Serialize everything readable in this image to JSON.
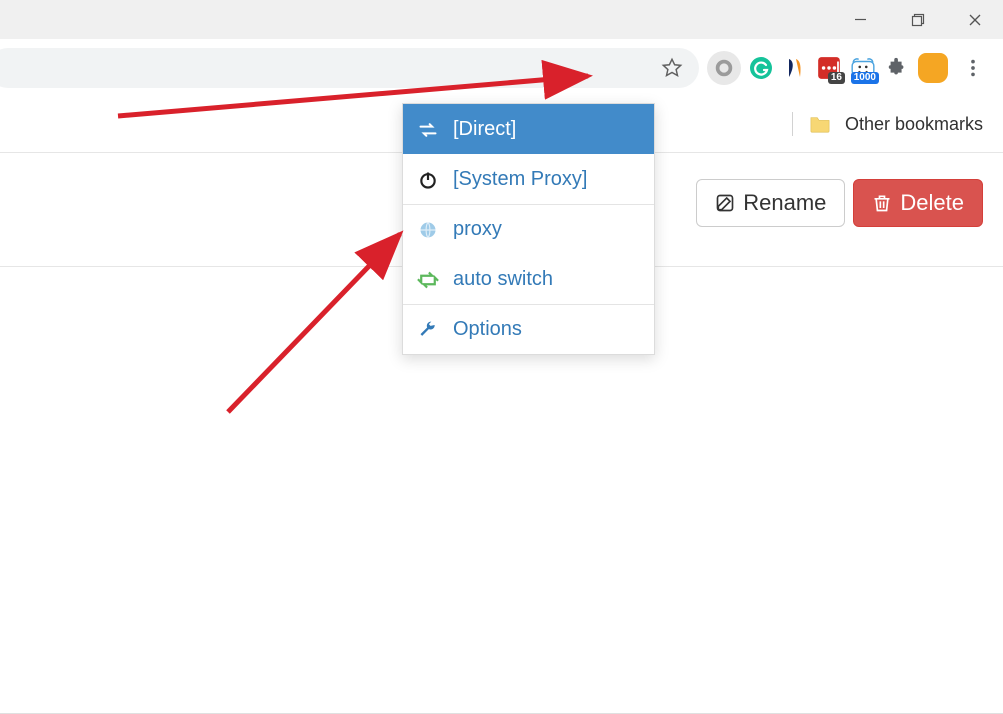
{
  "window_controls": {
    "min": "minimize-icon",
    "max": "maximize-icon",
    "close": "close-icon"
  },
  "extensions": {
    "star": "bookmark-star-icon",
    "items": [
      {
        "name": "switchyomega-icon",
        "badge": null
      },
      {
        "name": "grammarly-icon",
        "badge": null
      },
      {
        "name": "similarweb-icon",
        "badge": null
      },
      {
        "name": "lastpass-icon",
        "badge": "16",
        "badge_color": "#444"
      },
      {
        "name": "fatkun-icon",
        "badge": "1000",
        "badge_color": "#1a73e8"
      },
      {
        "name": "extensions-puzzle-icon",
        "badge": null
      }
    ],
    "avatar": "profile-avatar",
    "menu": "chrome-menu-icon"
  },
  "bookmarks": {
    "other_label": "Other bookmarks"
  },
  "page_buttons": {
    "rename": "Rename",
    "delete": "Delete"
  },
  "proxy_popup": {
    "items": [
      {
        "icon": "transfer-icon",
        "label": "[Direct]",
        "selected": true
      },
      {
        "icon": "power-icon",
        "label": "[System Proxy]",
        "selected": false
      },
      {
        "icon": "globe-icon",
        "label": "proxy",
        "selected": false,
        "sep": true
      },
      {
        "icon": "retweet-icon",
        "label": "auto switch",
        "selected": false
      },
      {
        "icon": "wrench-icon",
        "label": "Options",
        "selected": false,
        "sep": true
      }
    ]
  }
}
